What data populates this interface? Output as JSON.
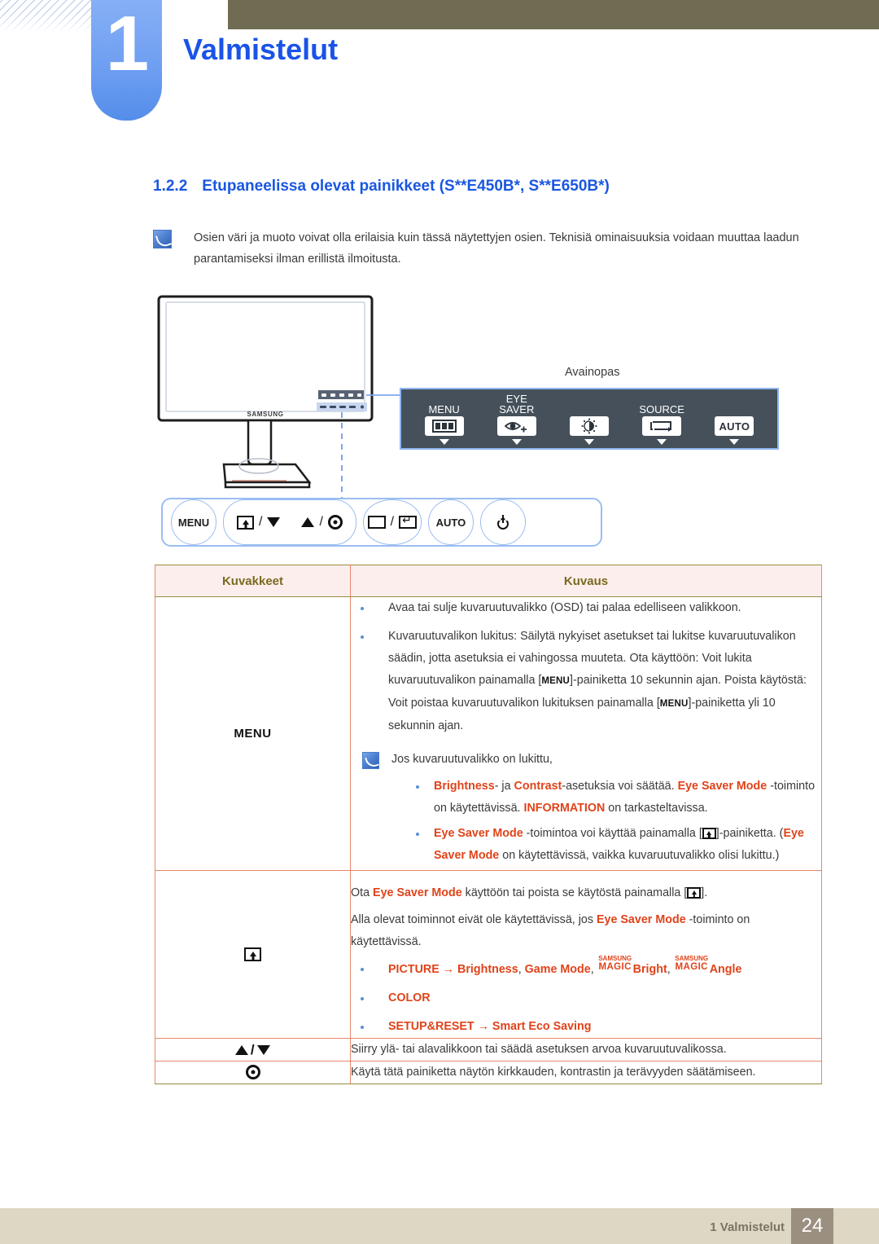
{
  "header": {
    "chapter_number": "1",
    "chapter_title": "Valmistelut"
  },
  "section": {
    "number": "1.2.2",
    "title": "Etupaneelissa olevat painikkeet (S**E450B*, S**E650B*)"
  },
  "note_top": {
    "icon": "note-icon",
    "text": "Osien väri ja muoto voivat olla erilaisia kuin tässä näytettyjen osien. Teknisiä ominaisuuksia voidaan muuttaa laadun parantamiseksi ilman erillistä ilmoitusta."
  },
  "illustration": {
    "brand_label": "SAMSUNG",
    "keyguide_label": "Avainopas",
    "keyguide_buttons": [
      {
        "caption": "MENU",
        "icon": "menu-bars-icon"
      },
      {
        "caption": "EYE\nSAVER",
        "icon": "eye-plus-icon"
      },
      {
        "caption": "",
        "icon": "brightness-icon"
      },
      {
        "caption": "SOURCE",
        "icon": "source-loop-icon"
      },
      {
        "caption": "",
        "icon": "auto-icon",
        "label": "AUTO"
      }
    ],
    "front_buttons": [
      {
        "label": "MENU",
        "icon": "menu-text-button"
      },
      {
        "label": "",
        "icon": "boxarrow-down-group"
      },
      {
        "label": "",
        "icon": "up-target-group"
      },
      {
        "label": "",
        "icon": "source-return-group"
      },
      {
        "label": "AUTO",
        "icon": "auto-button"
      },
      {
        "label": "",
        "icon": "power-icon"
      }
    ]
  },
  "table": {
    "headers": [
      "Kuvakkeet",
      "Kuvaus"
    ],
    "rows": [
      {
        "icon_label": "MENU",
        "icon_type": "text",
        "bullets": [
          "Avaa tai sulje kuvaruutuvalikko (OSD) tai palaa edelliseen valikkoon.",
          "Kuvaruutuvalikon lukitus: Säilytä nykyiset asetukset tai lukitse kuvaruutuvalikon säädin, jotta asetuksia ei vahingossa muuteta. Ota käyttöön: Voit lukita kuvaruutuvalikon painamalla [MENU]-painiketta 10 sekunnin ajan. Poista käytöstä: Voit poistaa kuvaruutuvalikon lukituksen painamalla [MENU]-painiketta yli 10 sekunnin ajan."
        ],
        "inner_note": {
          "intro": "Jos kuvaruutuvalikko on lukittu,",
          "bullets": [
            "Brightness- ja Contrast-asetuksia voi säätää. Eye Saver Mode -toiminto on käytettävissä. INFORMATION on tarkasteltavissa.",
            "Eye Saver Mode -toimintoa voi käyttää painamalla [ ]-painiketta. (Eye Saver Mode on käytettävissä, vaikka kuvaruutuvalikko olisi lukittu.)"
          ]
        }
      },
      {
        "icon_label": "",
        "icon_type": "boxarrow",
        "paras": [
          "Ota Eye Saver Mode käyttöön tai poista se käytöstä painamalla [ ].",
          "Alla olevat toiminnot eivät ole käytettävissä, jos Eye Saver Mode -toiminto on käytettävissä."
        ],
        "bullets": [
          "PICTURE → Brightness, Game Mode, SAMSUNG MAGIC Bright, SAMSUNG MAGIC Angle",
          "COLOR",
          "SETUP&RESET → Smart Eco Saving"
        ]
      },
      {
        "icon_label": "▲/▼",
        "icon_type": "arrows",
        "description": "Siirry ylä- tai alavalikkoon tai säädä asetuksen arvoa kuvaruutuvalikossa."
      },
      {
        "icon_label": "",
        "icon_type": "target",
        "description": "Käytä tätä painiketta näytön kirkkauden, kontrastin ja terävyyden säätämiseen."
      }
    ]
  },
  "footer": {
    "label": "1 Valmistelut",
    "page": "24"
  },
  "colors": {
    "heading_blue": "#1a57e0",
    "chapter_blue": "#1a53e8",
    "header_band": "#706c53",
    "tab_blue": "#6f9ff2",
    "table_border": "#e8876a",
    "table_header_bg": "#fdeeee",
    "table_header_text": "#7a6a1f",
    "accent_red": "#e0431a",
    "bullet_blue": "#5b8fd6",
    "footer_bar": "#ddd7c4",
    "footer_page": "#9b8f80",
    "keyguide_bg": "#45505a"
  }
}
